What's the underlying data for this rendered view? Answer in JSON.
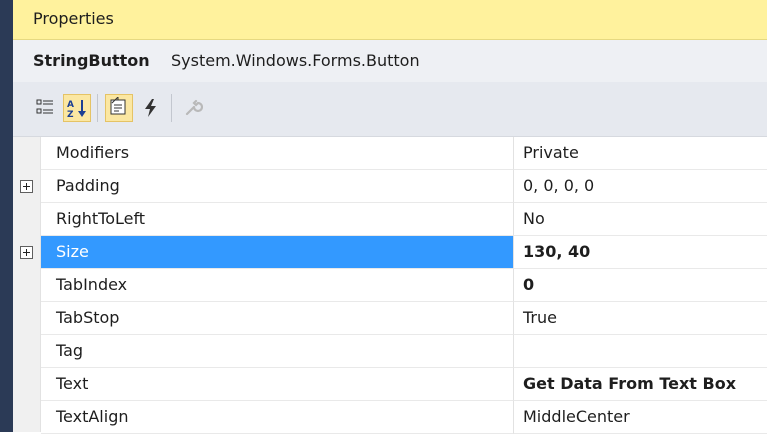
{
  "panel": {
    "title": "Properties",
    "object_name": "StringButton",
    "object_type": "System.Windows.Forms.Button"
  },
  "toolbar": {
    "buttons": [
      {
        "icon": "categorized-icon",
        "active": false
      },
      {
        "icon": "alphabetical-icon",
        "active": true
      },
      {
        "icon": "properties-icon",
        "active": true
      },
      {
        "icon": "events-lightning-icon",
        "active": false
      },
      {
        "icon": "property-pages-wrench-icon",
        "active": false,
        "disabled": true
      }
    ]
  },
  "properties": [
    {
      "name": "Modifiers",
      "value": "Private",
      "expandable": false,
      "bold": false
    },
    {
      "name": "Padding",
      "value": "0, 0, 0, 0",
      "expandable": true,
      "bold": false
    },
    {
      "name": "RightToLeft",
      "value": "No",
      "expandable": false,
      "bold": false
    },
    {
      "name": "Size",
      "value": "130, 40",
      "expandable": true,
      "bold": true,
      "selected": true
    },
    {
      "name": "TabIndex",
      "value": "0",
      "expandable": false,
      "bold": true
    },
    {
      "name": "TabStop",
      "value": "True",
      "expandable": false,
      "bold": false
    },
    {
      "name": "Tag",
      "value": "",
      "expandable": false,
      "bold": false
    },
    {
      "name": "Text",
      "value": "Get Data From Text Box",
      "expandable": false,
      "bold": true
    },
    {
      "name": "TextAlign",
      "value": "MiddleCenter",
      "expandable": false,
      "bold": false
    }
  ],
  "colors": {
    "title_bar": "#fff29d",
    "selection": "#3399ff",
    "left_edge": "#2b3a56"
  }
}
